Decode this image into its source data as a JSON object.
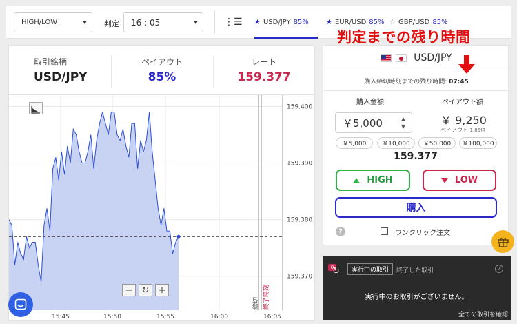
{
  "topbar": {
    "option_type": "HIGH/LOW",
    "judge_label": "判定",
    "judge_time": "16 : 05",
    "tabs": [
      {
        "pair": "USD/JPY",
        "payout": "85%",
        "star": "★"
      },
      {
        "pair": "EUR/USD",
        "payout": "85%",
        "star": "★"
      },
      {
        "pair": "GBP/USD",
        "payout": "85%",
        "star": "☆"
      }
    ]
  },
  "annotation": "判定までの残り時間",
  "stats": {
    "symbol_label": "取引銘柄",
    "symbol": "USD/JPY",
    "payout_label": "ペイアウト",
    "payout": "85%",
    "rate_label": "レート",
    "rate": "159.377"
  },
  "order": {
    "pair": "USD/JPY",
    "remaining_label": "購入締切時刻までの残り時間:",
    "remaining": "07:45",
    "amount_label": "購入金額",
    "payout_amount_label": "ペイアウト額",
    "amount": "￥5,000",
    "payout_amount": "￥ 9,250",
    "payout_multiplier_label": "ペイアウト",
    "payout_multiplier": "1.85倍",
    "quick_amounts": [
      "￥5,000",
      "￥10,000",
      "￥50,000",
      "￥100,000"
    ],
    "current_rate": "159.377",
    "high_label": "HIGH",
    "low_label": "LOW",
    "buy_label": "購入",
    "help": "?",
    "one_click_label": "ワンクリック注文"
  },
  "trades": {
    "badge": "0",
    "tab_active": "実行中の取引",
    "tab_inactive": "終了した取引",
    "empty_message": "実行中のお取引がございません。",
    "confirm_all": "全ての取引を確認"
  },
  "chart_data": {
    "type": "line",
    "x_ticks": [
      "15:45",
      "15:50",
      "15:55",
      "16:00",
      "16:05"
    ],
    "y_ticks": [
      "159.400",
      "159.390",
      "159.380",
      "159.370"
    ],
    "ylim": [
      159.364,
      159.402
    ],
    "current_rate": 159.377,
    "deadline_label": "締切",
    "end_label": "終了時刻",
    "series": [
      {
        "values": [
          159.38,
          159.379,
          159.372,
          159.376,
          159.374,
          159.373,
          159.377,
          159.375,
          159.376,
          159.376,
          159.372,
          159.369,
          159.379,
          159.382,
          159.378,
          159.389,
          159.391,
          159.387,
          159.392,
          159.388,
          159.393,
          159.39,
          159.396,
          159.395,
          159.392,
          159.39,
          159.39,
          159.392,
          159.395,
          159.389,
          159.394,
          159.397,
          159.399,
          159.397,
          159.395,
          159.399,
          159.399,
          159.395,
          159.394,
          159.396,
          159.393,
          159.391,
          159.397,
          159.397,
          159.389,
          159.394,
          159.392,
          159.394,
          159.399,
          159.392,
          159.387,
          159.382,
          159.379,
          159.382,
          159.378,
          159.378,
          159.374,
          159.376,
          159.377
        ]
      }
    ],
    "colors": {
      "line": "#2b4fd8",
      "fill": "#c8d3f3"
    }
  }
}
